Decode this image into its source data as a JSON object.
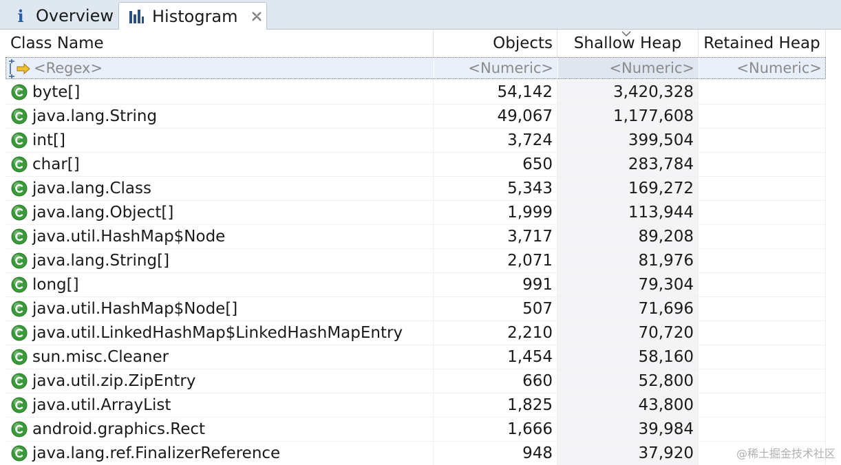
{
  "tabs": [
    {
      "label": "Overview",
      "icon": "info-icon"
    },
    {
      "label": "Histogram",
      "icon": "histogram-icon",
      "active": true
    }
  ],
  "columns": [
    "Class Name",
    "Objects",
    "Shallow Heap",
    "Retained Heap"
  ],
  "filters": {
    "name": "<Regex>",
    "objects": "<Numeric>",
    "shallow": "<Numeric>",
    "retained": "<Numeric>"
  },
  "rows": [
    {
      "name": "byte[]",
      "objects": "54,142",
      "shallow": "3,420,328"
    },
    {
      "name": "java.lang.String",
      "objects": "49,067",
      "shallow": "1,177,608"
    },
    {
      "name": "int[]",
      "objects": "3,724",
      "shallow": "399,504"
    },
    {
      "name": "char[]",
      "objects": "650",
      "shallow": "283,784"
    },
    {
      "name": "java.lang.Class",
      "objects": "5,343",
      "shallow": "169,272"
    },
    {
      "name": "java.lang.Object[]",
      "objects": "1,999",
      "shallow": "113,944"
    },
    {
      "name": "java.util.HashMap$Node",
      "objects": "3,717",
      "shallow": "89,208"
    },
    {
      "name": "java.lang.String[]",
      "objects": "2,071",
      "shallow": "81,976"
    },
    {
      "name": "long[]",
      "objects": "991",
      "shallow": "79,304"
    },
    {
      "name": "java.util.HashMap$Node[]",
      "objects": "507",
      "shallow": "71,696"
    },
    {
      "name": "java.util.LinkedHashMap$LinkedHashMapEntry",
      "objects": "2,210",
      "shallow": "70,720"
    },
    {
      "name": "sun.misc.Cleaner",
      "objects": "1,454",
      "shallow": "58,160"
    },
    {
      "name": "java.util.zip.ZipEntry",
      "objects": "660",
      "shallow": "52,800"
    },
    {
      "name": "java.util.ArrayList",
      "objects": "1,825",
      "shallow": "43,800"
    },
    {
      "name": "android.graphics.Rect",
      "objects": "1,666",
      "shallow": "39,984"
    },
    {
      "name": "java.lang.ref.FinalizerReference",
      "objects": "948",
      "shallow": "37,920"
    }
  ],
  "watermark": "@稀土掘金技术社区",
  "colors": {
    "class_icon": "#3a9a3a",
    "tabbar": "#dfe7f1",
    "filter_row": "#e8eff8"
  }
}
